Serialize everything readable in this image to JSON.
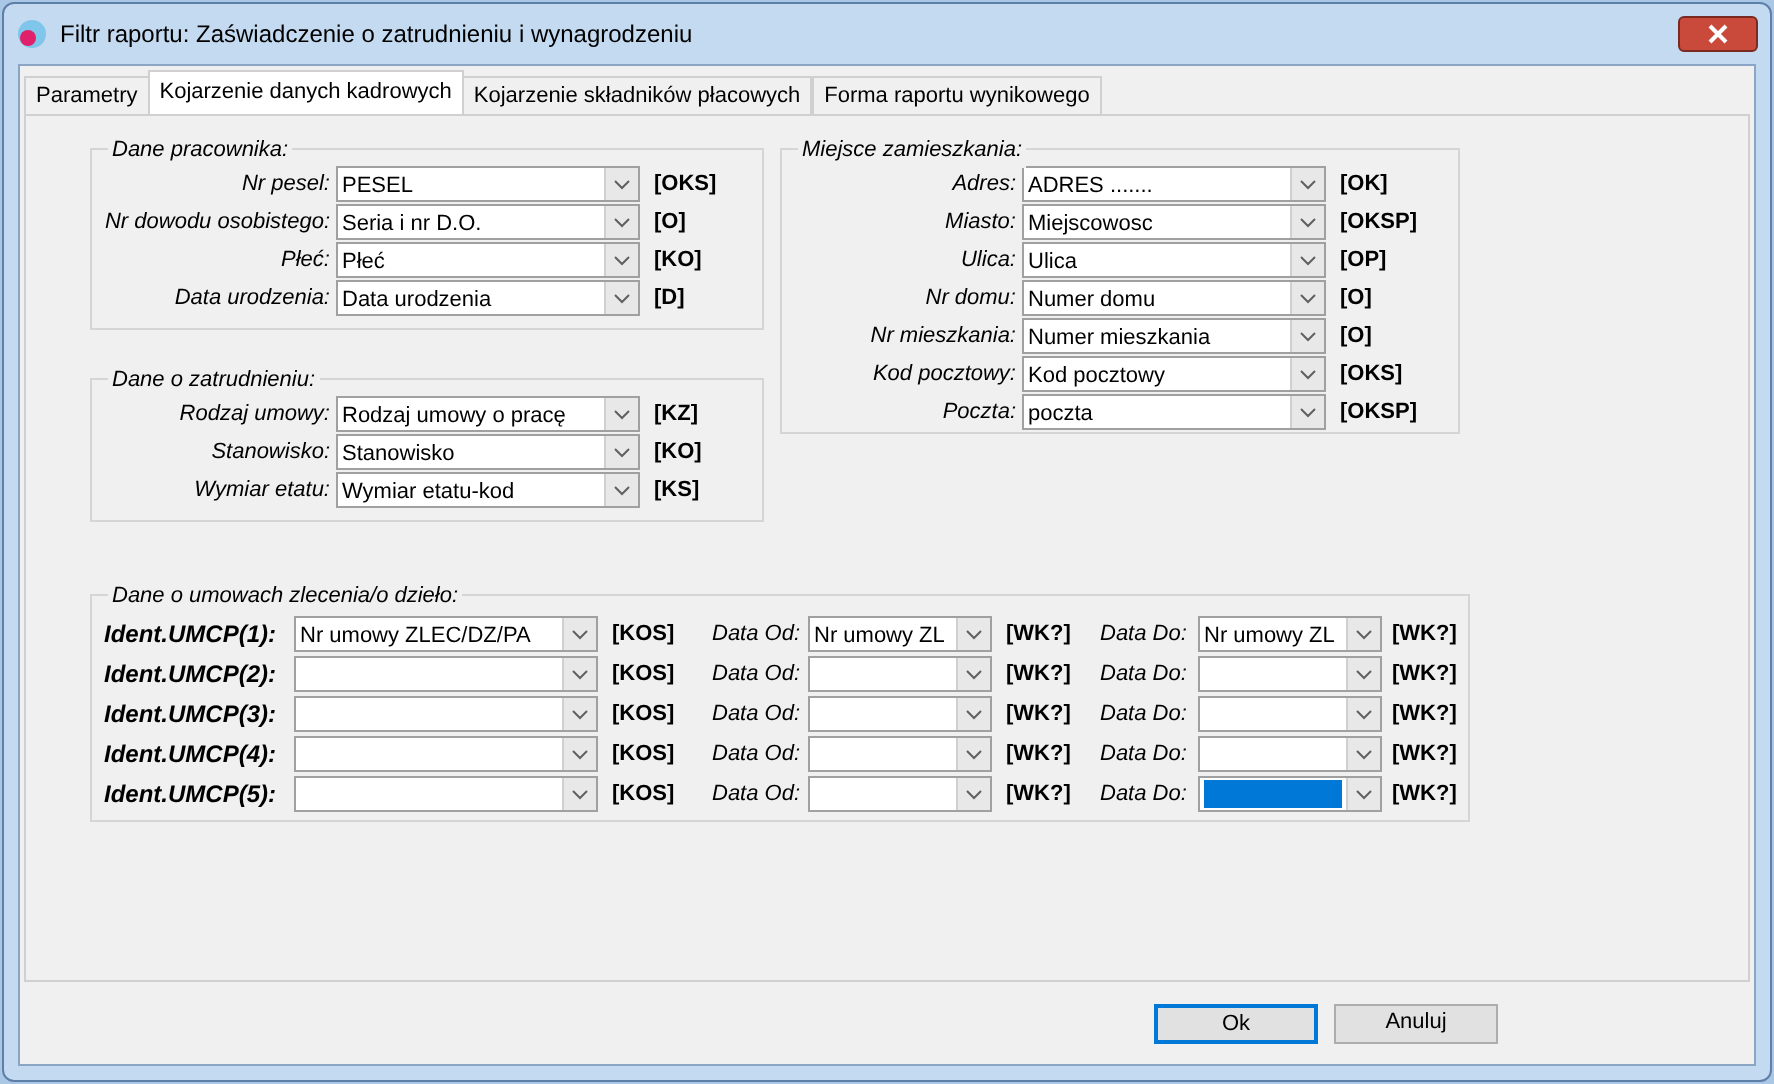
{
  "window": {
    "title": "Filtr raportu: Zaświadczenie o zatrudnieniu i wynagrodzeniu"
  },
  "tabs": [
    {
      "label": "Parametry",
      "selected": false
    },
    {
      "label": "Kojarzenie danych kadrowych",
      "selected": true
    },
    {
      "label": "Kojarzenie składników płacowych",
      "selected": false
    },
    {
      "label": "Forma raportu wynikowego",
      "selected": false
    }
  ],
  "employee": {
    "title": "Dane pracownika:",
    "rows": [
      {
        "label": "Nr pesel:",
        "value": "PESEL",
        "code": "[OKS]"
      },
      {
        "label": "Nr dowodu osobistego:",
        "value": "Seria i nr D.O.",
        "code": "[O]"
      },
      {
        "label": "Płeć:",
        "value": "Płeć",
        "code": "[KO]"
      },
      {
        "label": "Data urodzenia:",
        "value": "Data urodzenia",
        "code": "[D]"
      }
    ]
  },
  "employment": {
    "title": "Dane o zatrudnieniu:",
    "rows": [
      {
        "label": "Rodzaj umowy:",
        "value": "Rodzaj umowy o pracę",
        "code": "[KZ]"
      },
      {
        "label": "Stanowisko:",
        "value": "Stanowisko",
        "code": "[KO]"
      },
      {
        "label": "Wymiar etatu:",
        "value": "Wymiar etatu-kod",
        "code": "[KS]"
      }
    ]
  },
  "residence": {
    "title": "Miejsce zamieszkania:",
    "rows": [
      {
        "label": "Adres:",
        "value": "ADRES .......",
        "code": "[OK]"
      },
      {
        "label": "Miasto:",
        "value": "Miejscowosc",
        "code": "[OKSP]"
      },
      {
        "label": "Ulica:",
        "value": "Ulica",
        "code": "[OP]"
      },
      {
        "label": "Nr domu:",
        "value": "Numer domu",
        "code": "[O]"
      },
      {
        "label": "Nr mieszkania:",
        "value": "Numer mieszkania",
        "code": "[O]"
      },
      {
        "label": "Kod pocztowy:",
        "value": "Kod pocztowy",
        "code": "[OKS]"
      },
      {
        "label": "Poczta:",
        "value": "poczta",
        "code": "[OKSP]"
      }
    ]
  },
  "contracts": {
    "title": "Dane o umowach zlecenia/o dzieło:",
    "rows": [
      {
        "label": "Ident.UMCP(1):",
        "value": "Nr umowy ZLEC/DZ/PA",
        "code": "[KOS]",
        "from_label": "Data Od:",
        "from_value": "Nr umowy ZL",
        "from_code": "[WK?]",
        "to_label": "Data Do:",
        "to_value": "Nr umowy ZL",
        "to_code": "[WK?]",
        "to_focused": false
      },
      {
        "label": "Ident.UMCP(2):",
        "code": "[KOS]",
        "from_label": "Data Od:",
        "from_code": "[WK?]",
        "to_label": "Data Do:",
        "to_code": "[WK?]",
        "to_focused": false
      },
      {
        "label": "Ident.UMCP(3):",
        "code": "[KOS]",
        "from_label": "Data Od:",
        "from_code": "[WK?]",
        "to_label": "Data Do:",
        "to_code": "[WK?]",
        "to_focused": false
      },
      {
        "label": "Ident.UMCP(4):",
        "code": "[KOS]",
        "from_label": "Data Od:",
        "from_code": "[WK?]",
        "to_label": "Data Do:",
        "to_code": "[WK?]",
        "to_focused": false
      },
      {
        "label": "Ident.UMCP(5):",
        "code": "[KOS]",
        "from_label": "Data Od:",
        "from_code": "[WK?]",
        "to_label": "Data Do:",
        "to_code": "[WK?]",
        "to_focused": true
      }
    ]
  },
  "buttons": [
    {
      "label": "Ok",
      "default": true
    },
    {
      "label": "Anuluj",
      "default": false
    }
  ]
}
